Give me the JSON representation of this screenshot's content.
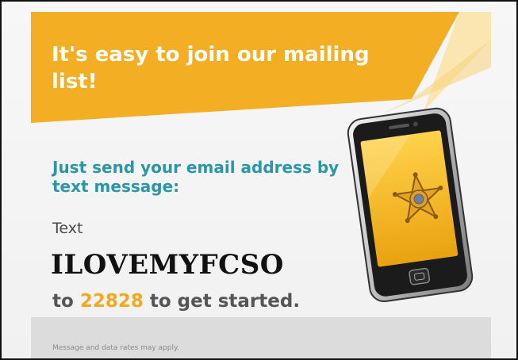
{
  "promo": {
    "headline": "It's easy to join our mailing list!",
    "subhead": "Just send your email address by text message:",
    "text_label": "Text",
    "keyword": "ILOVEMYFCSO",
    "cta_prefix": "to",
    "short_code": "22828",
    "cta_suffix": "to get started.",
    "disclaimer": "Message and data rates may apply."
  },
  "colors": {
    "banner": "#f3ae24",
    "heading_teal": "#2a97a8",
    "number_orange": "#f3a81e",
    "phone_screen": "#f2b21c",
    "footer_gray": "#dcdcdc"
  },
  "icons": {
    "phone": "smartphone-icon",
    "badge": "sheriff-star-badge-icon"
  }
}
